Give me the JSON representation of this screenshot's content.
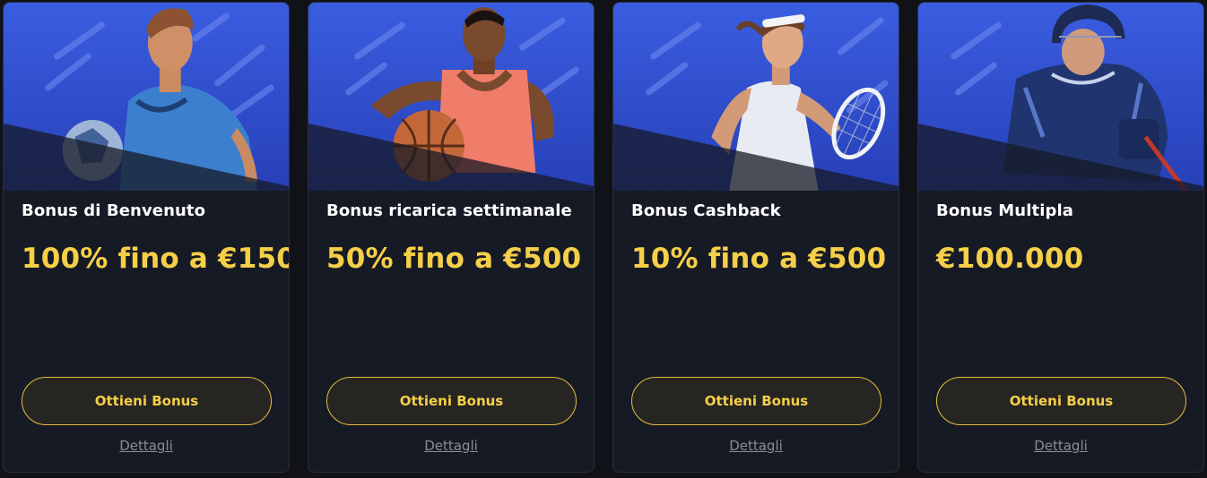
{
  "colors": {
    "accent": "#f5cf48",
    "card_bg": "#161a25",
    "banner_blue": "#3a5de0",
    "button_bg": "#262522"
  },
  "cards": [
    {
      "title": "Bonus di Benvenuto",
      "amount": "100% fino a €150",
      "button_label": "Ottieni Bonus",
      "details_label": "Dettagli",
      "illustration": "football-player-image"
    },
    {
      "title": "Bonus ricarica settimanale",
      "amount": "50% fino a €500",
      "button_label": "Ottieni Bonus",
      "details_label": "Dettagli",
      "illustration": "basketball-player-image"
    },
    {
      "title": "Bonus Cashback",
      "amount": "10% fino a €500",
      "button_label": "Ottieni Bonus",
      "details_label": "Dettagli",
      "illustration": "tennis-player-image"
    },
    {
      "title": "Bonus Multipla",
      "amount": "€100.000",
      "button_label": "Ottieni Bonus",
      "details_label": "Dettagli",
      "illustration": "hockey-player-image"
    }
  ]
}
